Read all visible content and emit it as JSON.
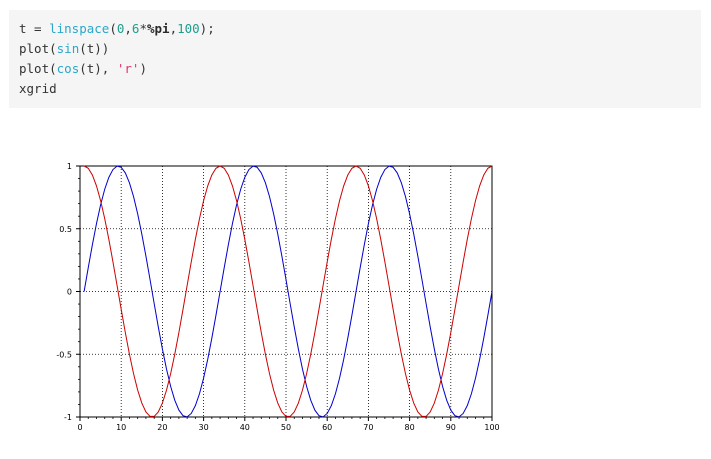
{
  "code": {
    "line1": {
      "a": "t = ",
      "b": "linspace",
      "c": "(",
      "d": "0",
      "e": ",",
      "f": "6",
      "g": "*",
      "h": "%pi",
      "i": ",",
      "j": "100",
      "k": ");"
    },
    "line2": {
      "a": "plot(",
      "b": "sin",
      "c": "(t))"
    },
    "line3": {
      "a": "plot(",
      "b": "cos",
      "c": "(t), ",
      "d": "'r'",
      "e": ")"
    },
    "line4": {
      "a": "xgrid"
    }
  },
  "colors": {
    "sin": "#0000cc",
    "cos": "#cc0000",
    "grid": "#000000",
    "code_background": "#f5f5f5"
  },
  "chart_data": {
    "type": "line",
    "title": "",
    "xlabel": "",
    "ylabel": "",
    "xlim": [
      0,
      100
    ],
    "ylim": [
      -1,
      1
    ],
    "grid": true,
    "x_ticks": [
      "0",
      "10",
      "20",
      "30",
      "40",
      "50",
      "60",
      "70",
      "80",
      "90",
      "100"
    ],
    "y_ticks": [
      "1",
      "0.5",
      "0",
      "-0.5",
      "-1"
    ],
    "x": "index 1..100",
    "series": [
      {
        "expr": "sin(t)",
        "color": "#0000cc"
      },
      {
        "expr": "cos(t)",
        "color": "#cc0000"
      }
    ],
    "t_range": [
      0,
      18.849556
    ],
    "n_points": 100
  }
}
